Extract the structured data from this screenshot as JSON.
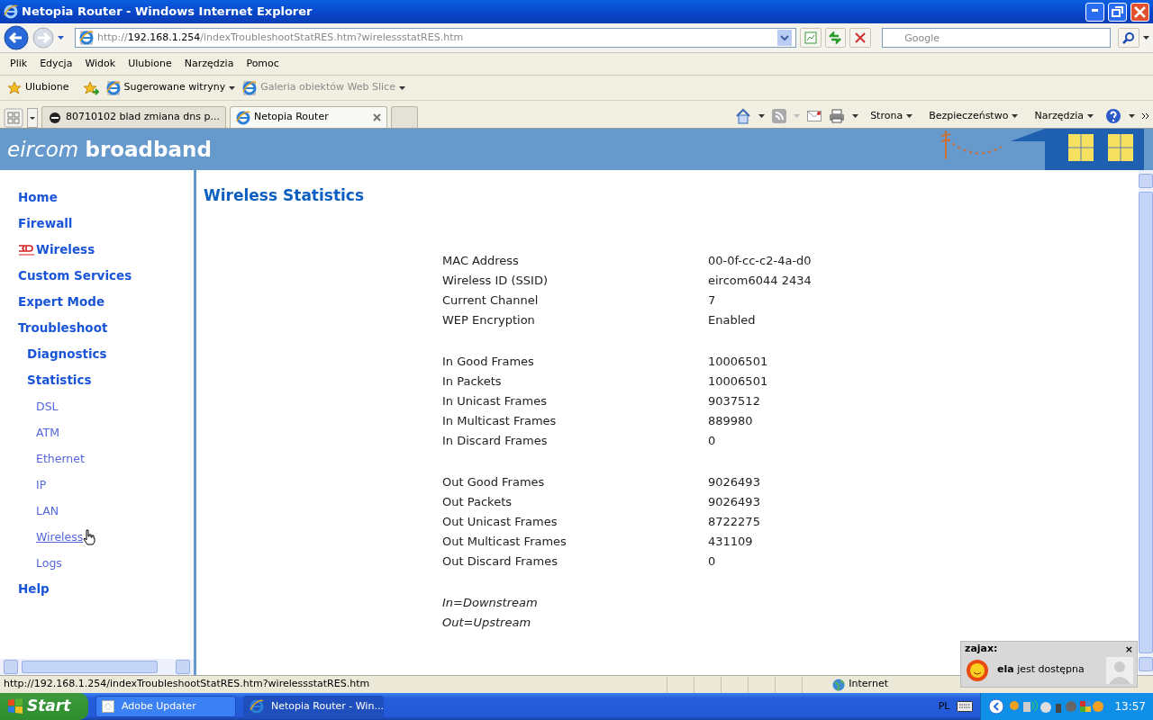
{
  "window": {
    "title": "Netopia Router - Windows Internet Explorer"
  },
  "address_bar": {
    "scheme": "http://",
    "host": "192.168.1.254",
    "path": "/indexTroubleshootStatRES.htm?wirelessstatRES.htm"
  },
  "search": {
    "placeholder": "Google"
  },
  "menu": [
    "Plik",
    "Edycja",
    "Widok",
    "Ulubione",
    "Narzędzia",
    "Pomoc"
  ],
  "favorites_bar": {
    "favorites": "Ulubione",
    "items": [
      {
        "label": "Sugerowane witryny",
        "disabled": false
      },
      {
        "label": "Galeria obiektów Web Slice",
        "disabled": true
      }
    ]
  },
  "tabs": [
    {
      "label": "80710102 blad zmiana dns p...",
      "selected": false
    },
    {
      "label": "Netopia Router",
      "selected": true
    }
  ],
  "command_bar": [
    "Strona",
    "Bezpieczeństwo",
    "Narzędzia"
  ],
  "page": {
    "logo": {
      "light": "eircom",
      "bold": "broadband"
    },
    "nav": [
      {
        "label": "Home"
      },
      {
        "label": "Firewall"
      },
      {
        "label": "Wireless",
        "kind": "badged"
      },
      {
        "label": "Custom Services"
      },
      {
        "label": "Expert Mode"
      },
      {
        "label": "Troubleshoot",
        "children": [
          {
            "label": "Diagnostics"
          },
          {
            "label": "Statistics",
            "children": [
              {
                "label": "DSL",
                "hovered": false
              },
              {
                "label": "ATM",
                "hovered": false
              },
              {
                "label": "Ethernet",
                "hovered": false
              },
              {
                "label": "IP",
                "hovered": false
              },
              {
                "label": "LAN",
                "hovered": false
              },
              {
                "label": "Wireless",
                "hovered": true
              },
              {
                "label": "Logs",
                "hovered": false
              }
            ]
          }
        ]
      },
      {
        "label": "Help"
      }
    ],
    "heading": "Wireless Statistics",
    "stat_groups": [
      [
        {
          "label": "MAC Address",
          "value": "00-0f-cc-c2-4a-d0"
        },
        {
          "label": "Wireless ID (SSID)",
          "value": "eircom6044 2434"
        },
        {
          "label": "Current Channel",
          "value": "7"
        },
        {
          "label": "WEP Encryption",
          "value": "Enabled"
        }
      ],
      [
        {
          "label": "In Good Frames",
          "value": "10006501"
        },
        {
          "label": "In Packets",
          "value": "10006501"
        },
        {
          "label": "In Unicast Frames",
          "value": "9037512"
        },
        {
          "label": "In Multicast Frames",
          "value": "889980"
        },
        {
          "label": "In Discard Frames",
          "value": "0"
        }
      ],
      [
        {
          "label": "Out Good Frames",
          "value": "9026493"
        },
        {
          "label": "Out Packets",
          "value": "9026493"
        },
        {
          "label": "Out Unicast Frames",
          "value": "8722275"
        },
        {
          "label": "Out Multicast Frames",
          "value": "431109"
        },
        {
          "label": "Out Discard Frames",
          "value": "0"
        }
      ]
    ],
    "notes": [
      "In=Downstream",
      "Out=Upstream"
    ]
  },
  "status_bar": {
    "text": "http://192.168.1.254/indexTroubleshootStatRES.htm?wirelessstatRES.htm",
    "zone": "Internet"
  },
  "notification": {
    "title": "zajax:",
    "close": "×",
    "message": "**ela** jest dostępna"
  },
  "taskbar": {
    "start": "Start",
    "tasks": [
      {
        "label": "Adobe Updater",
        "selected": false
      },
      {
        "label": "Netopia Router - Win...",
        "selected": true
      }
    ],
    "language": "PL",
    "clock": "13:57"
  }
}
